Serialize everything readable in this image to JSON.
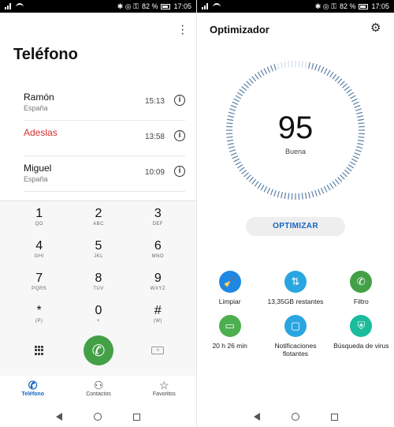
{
  "status": {
    "time": "17:05",
    "battery": "82 %"
  },
  "phone": {
    "title": "Teléfono",
    "calls": [
      {
        "name": "Ramón",
        "location": "España",
        "time": "15:13",
        "missed": false
      },
      {
        "name": "Adeslas",
        "location": "",
        "time": "13:58",
        "missed": true
      },
      {
        "name": "Miguel",
        "location": "España",
        "time": "10:09",
        "missed": false
      }
    ],
    "keys": [
      {
        "digit": "1",
        "sub": "QO"
      },
      {
        "digit": "2",
        "sub": "ABC"
      },
      {
        "digit": "3",
        "sub": "DEF"
      },
      {
        "digit": "4",
        "sub": "GHI"
      },
      {
        "digit": "5",
        "sub": "JKL"
      },
      {
        "digit": "6",
        "sub": "MNO"
      },
      {
        "digit": "7",
        "sub": "PQRS"
      },
      {
        "digit": "8",
        "sub": "TUV"
      },
      {
        "digit": "9",
        "sub": "WXYZ"
      },
      {
        "digit": "*",
        "sub": "(P)"
      },
      {
        "digit": "0",
        "sub": "+"
      },
      {
        "digit": "#",
        "sub": "(W)"
      }
    ],
    "tabs": [
      "Teléfono",
      "Contactos",
      "Favoritos"
    ]
  },
  "optimizer": {
    "title": "Optimizador",
    "score": "95",
    "score_label": "Buena",
    "button": "OPTIMIZAR",
    "tools": [
      {
        "label": "Limpiar",
        "icon": "broom-icon",
        "color": "#1e88e5"
      },
      {
        "label": "13,35GB restantes",
        "icon": "transfer-arrows-icon",
        "color": "#29a6e0"
      },
      {
        "label": "Filtro",
        "icon": "phone-block-icon",
        "color": "#43a047"
      },
      {
        "label": "20 h 26 min",
        "icon": "battery-icon",
        "color": "#4caf50"
      },
      {
        "label": "Notificaciones flotantes",
        "icon": "notification-icon",
        "color": "#29a6e0"
      },
      {
        "label": "Búsqueda de virus",
        "icon": "shield-search-icon",
        "color": "#1abc9c"
      }
    ],
    "colors": {
      "accent": "#1565c0",
      "gauge": "#5b7fa6"
    }
  }
}
